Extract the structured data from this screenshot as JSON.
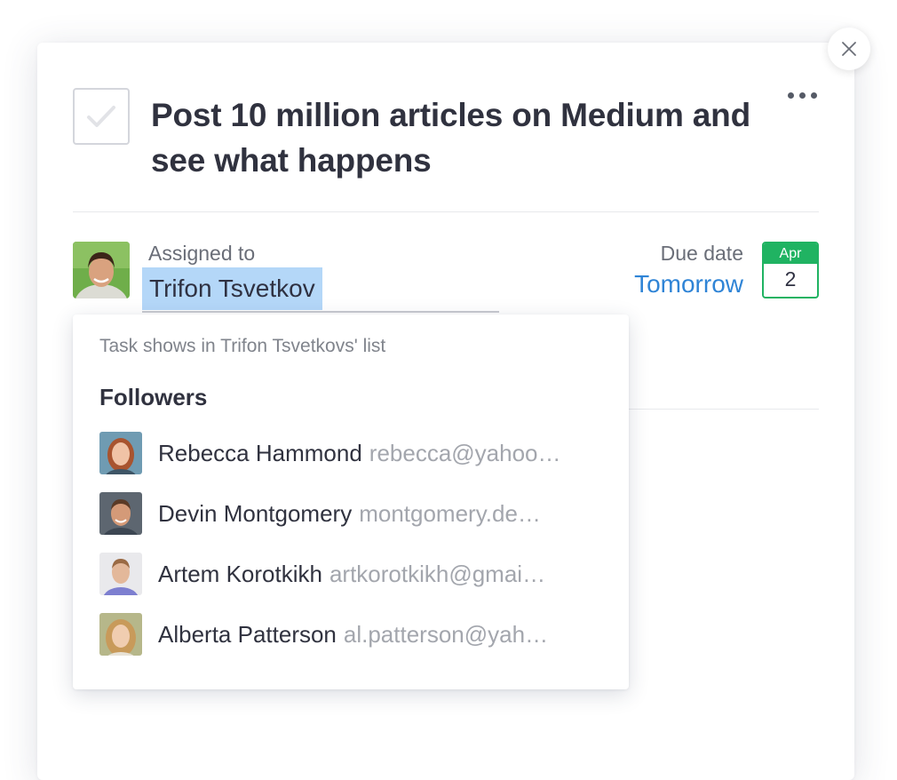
{
  "task": {
    "title": "Post 10 million articles on Medium and see what happens",
    "completed": false
  },
  "assignment": {
    "label": "Assigned to",
    "assignee": "Trifon Tsvetkov"
  },
  "due": {
    "label": "Due date",
    "value": "Tomorrow",
    "calendar_month": "Apr",
    "calendar_day": "2"
  },
  "dropdown": {
    "hint": "Task shows in Trifon Tsvetkovs' list",
    "heading": "Followers",
    "followers": [
      {
        "name": "Rebecca Hammond",
        "email": "rebecca@yahoo…"
      },
      {
        "name": "Devin Montgomery",
        "email": "montgomery.de…"
      },
      {
        "name": "Artem Korotkikh",
        "email": "artkorotkikh@gmai…"
      },
      {
        "name": "Alberta Patterson",
        "email": "al.patterson@yah…"
      }
    ]
  },
  "icons": {
    "close": "close-icon",
    "more": "more-icon",
    "check": "check-icon"
  },
  "colors": {
    "accent_blue": "#2f84d6",
    "calendar_green": "#20b362",
    "selection": "#b4d7f8"
  }
}
